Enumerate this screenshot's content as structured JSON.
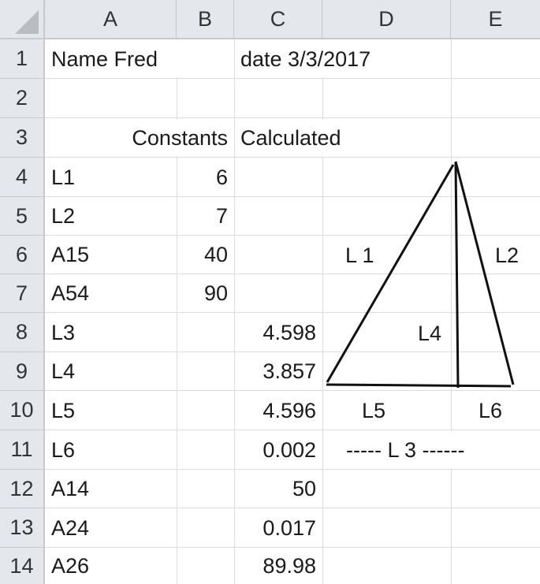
{
  "columns": [
    "A",
    "B",
    "C",
    "D",
    "E"
  ],
  "rows": [
    "1",
    "2",
    "3",
    "4",
    "5",
    "6",
    "7",
    "8",
    "9",
    "10",
    "11",
    "12",
    "13",
    "14"
  ],
  "cells": {
    "A1": "Name  Fred",
    "C1": "date  3/3/2017",
    "B3": "Constants",
    "C3": "Calculated",
    "A4": "L1",
    "B4": "6",
    "A5": "L2",
    "B5": "7",
    "A6": "A15",
    "B6": "40",
    "A7": "A54",
    "B7": "90",
    "A8": "L3",
    "C8": "4.598",
    "A9": "L4",
    "C9": "3.857",
    "A10": "L5",
    "C10": "4.596",
    "A11": "L6",
    "C11": "0.002",
    "A12": "A14",
    "C12": "50",
    "A13": "A24",
    "C13": "0.017",
    "A14": "A26",
    "C14": "89.98",
    "D10": "L5",
    "E10": "L6",
    "D11": "----- L 3 ------"
  },
  "diagram": {
    "labels": {
      "side_left": "L 1",
      "side_right": "L2",
      "height": "L4"
    },
    "stroke_color": "#111111"
  }
}
